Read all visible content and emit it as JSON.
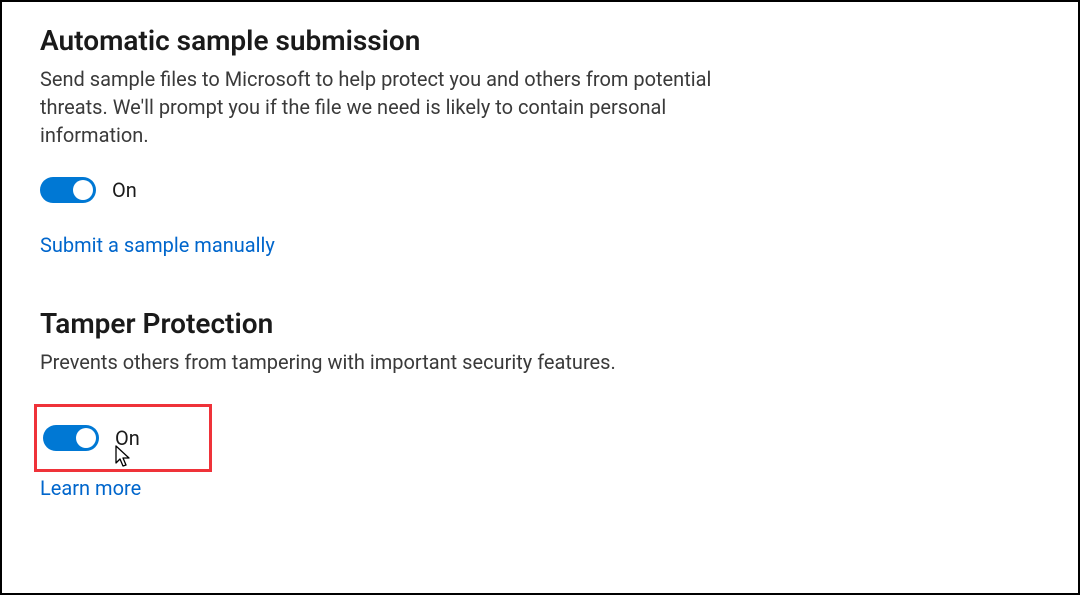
{
  "colors": {
    "accent": "#0078d4",
    "link": "#0066cc",
    "highlight_border": "#ef3239"
  },
  "sections": {
    "autosample": {
      "title": "Automatic sample submission",
      "description": "Send sample files to Microsoft to help protect you and others from potential threats. We'll prompt you if the file we need is likely to contain personal information.",
      "toggle_state": "On",
      "link_label": "Submit a sample manually"
    },
    "tamper": {
      "title": "Tamper Protection",
      "description": "Prevents others from tampering with important security features.",
      "toggle_state": "On",
      "link_label": "Learn more"
    }
  }
}
